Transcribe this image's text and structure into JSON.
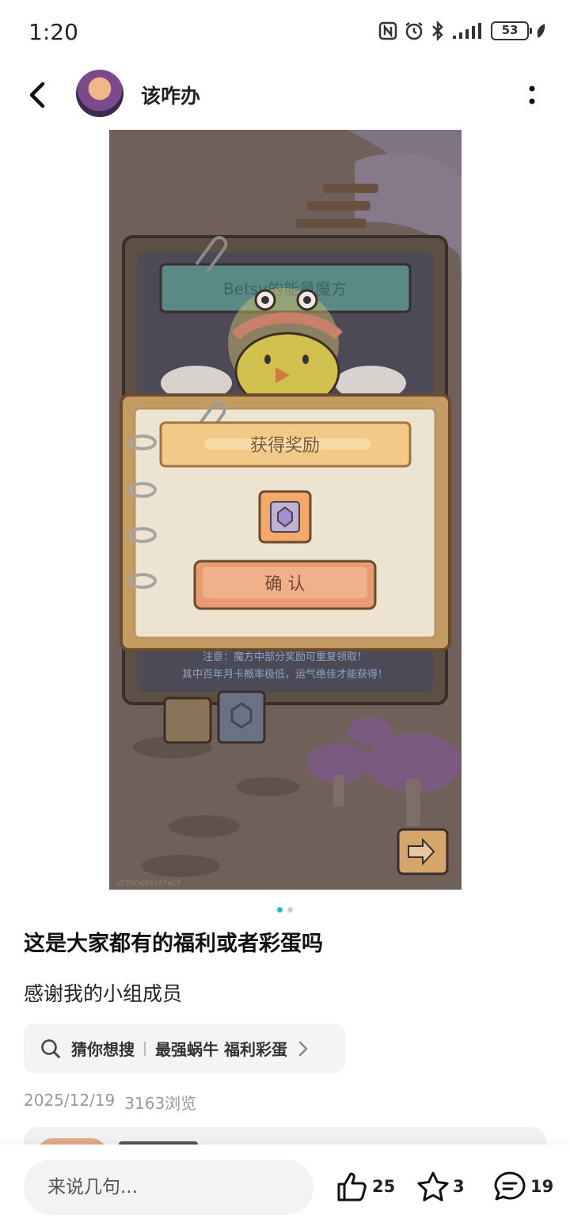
{
  "status_bar": {
    "time": "1:20",
    "battery": "53",
    "icons": [
      "nfc-icon",
      "alarm-icon",
      "bluetooth-icon",
      "signal-icon",
      "battery-icon",
      "leaf-icon"
    ]
  },
  "header": {
    "back_icon": "back-arrow-icon",
    "user_name": "该咋办",
    "more_icon": "more-vertical-icon"
  },
  "post_image": {
    "banner_text": "Betsy的能量魔方",
    "dialog_title": "获得奖励",
    "confirm_label": "确 认",
    "notice_line_1": "注意：魔方中部分奖励可重复领取！",
    "notice_line_2": "其中百年月卡概率极低，运气绝佳才能获得！",
    "watermark": "UFZ0D6B0187ACF"
  },
  "carousel": {
    "count": 2,
    "active_index": 0
  },
  "post": {
    "title": "这是大家都有的福利或者彩蛋吗",
    "body": "感谢我的小组成员",
    "search_chip": {
      "prefix": "猜你想搜",
      "query": "最强蜗牛 福利彩蛋"
    },
    "date": "2025/12/19",
    "views": "3163浏览"
  },
  "bottom_bar": {
    "comment_placeholder": "来说几句...",
    "like_count": "25",
    "favorite_count": "3",
    "comment_count": "19"
  },
  "colors": {
    "accent_teal": "#1cc6b4",
    "chip_bg": "#f3f4f6",
    "muted_text": "#999999"
  }
}
